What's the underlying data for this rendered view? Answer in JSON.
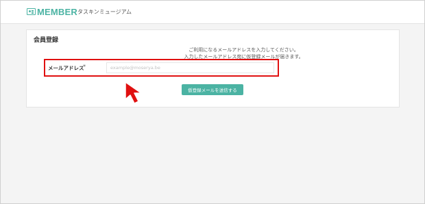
{
  "header": {
    "logo_text": "MEMBER",
    "museum_name": "タスキンミュージアム",
    "logo_icon": "member-card-icon",
    "brand_color": "#4bb3a3"
  },
  "form": {
    "title": "会員登録",
    "help_line1": "ご利用になるメールアドレスを入力してください。",
    "help_line2": "入力したメールアドレス宛に仮登録メールが届きます。",
    "email_label": "メールアドレス",
    "required_mark": "*",
    "email_value": "",
    "email_placeholder": "example@moserya.be",
    "submit_label": "仮登録メールを送信する"
  },
  "annotation": {
    "highlight_color": "#e01010",
    "pointer_icon": "arrow-cursor-icon"
  }
}
